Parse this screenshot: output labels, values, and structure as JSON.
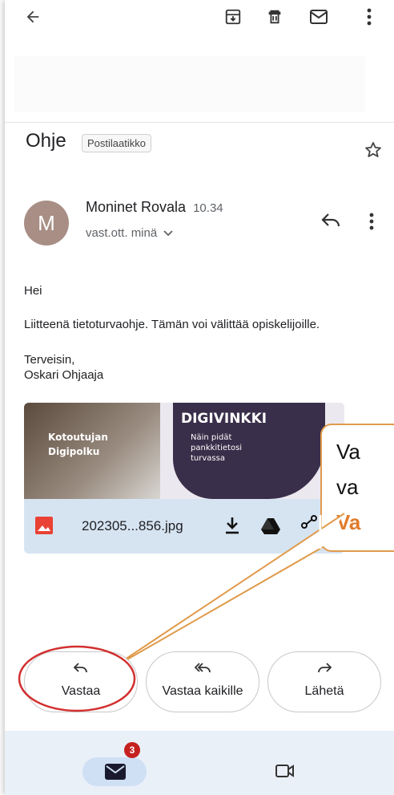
{
  "toolbar": {
    "back_icon": "arrow-left-icon",
    "archive_icon": "archive-icon",
    "delete_icon": "trash-icon",
    "mark_unread_icon": "mail-icon",
    "more_icon": "more-vert-icon"
  },
  "email": {
    "subject": "Ohje",
    "label": "Postilaatikko",
    "sender_initial": "M",
    "sender_name": "Moninet Rovala",
    "time": "10.34",
    "recipient_line": "vast.ott. minä",
    "greeting": "Hei",
    "message": "Liitteenä tietoturvaohje. Tämän voi välittää opiskelijoille.",
    "closing": "Terveisin,",
    "signature": "Oskari Ohjaaja"
  },
  "attachment": {
    "filename": "202305...856.jpg",
    "preview_title": "DIGIVINKKI",
    "preview_subtitle_1": "Näin pidät",
    "preview_subtitle_2": "pankkitietosi",
    "preview_subtitle_3": "turvassa",
    "preview_left_1": "Kotoutujan",
    "preview_left_2": "Digipolku"
  },
  "callout": {
    "line1": "Va",
    "line2": "va",
    "line3": "Va"
  },
  "actions": {
    "reply": "Vastaa",
    "reply_all": "Vastaa kaikille",
    "forward": "Lähetä"
  },
  "bottom_nav": {
    "mail_badge": "3"
  },
  "colors": {
    "accent_orange": "#e07b2a",
    "highlight_red": "#d32f2f",
    "bottom_bar": "#eaf0f8",
    "attachment_bg": "#d6e4f2"
  }
}
